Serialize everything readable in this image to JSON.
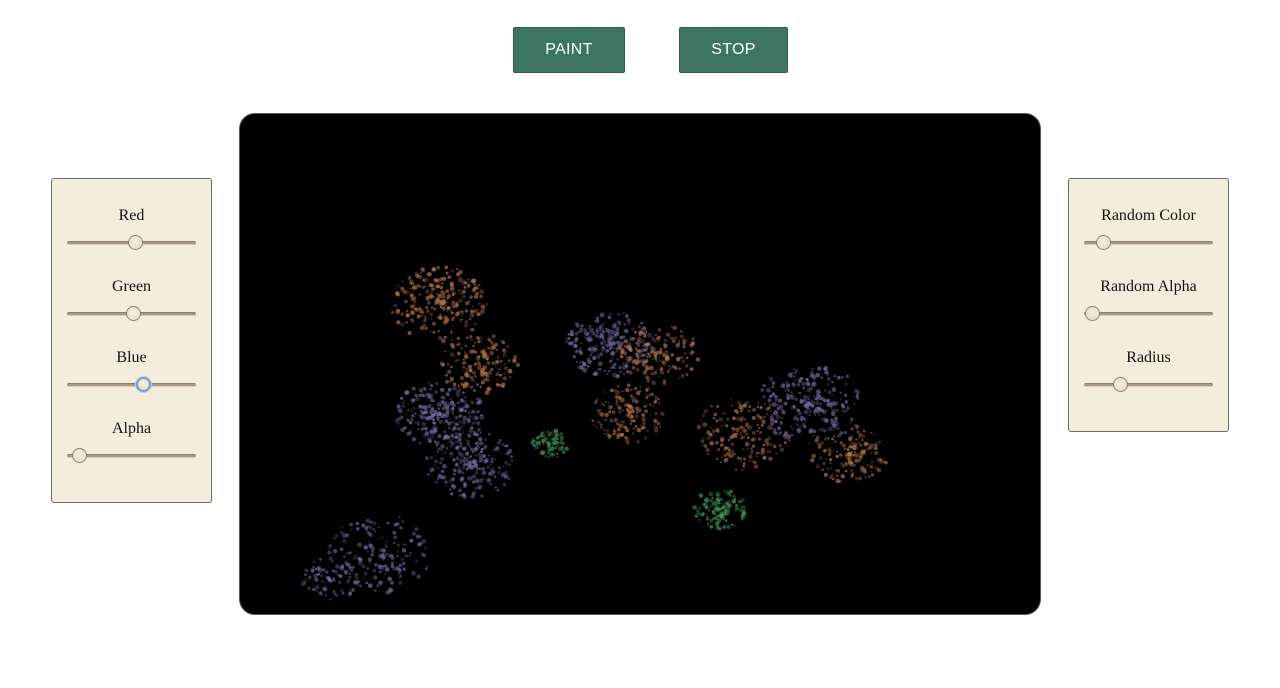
{
  "toolbar": {
    "paint_label": "PAINT",
    "stop_label": "STOP"
  },
  "left_panel": {
    "controls": [
      {
        "label": "Red",
        "value": 0.53
      },
      {
        "label": "Green",
        "value": 0.51
      },
      {
        "label": "Blue",
        "value": 0.59,
        "focused": true
      },
      {
        "label": "Alpha",
        "value": 0.09
      }
    ]
  },
  "right_panel": {
    "controls": [
      {
        "label": "Random Color",
        "value": 0.15
      },
      {
        "label": "Random Alpha",
        "value": 0.06
      },
      {
        "label": "Radius",
        "value": 0.28
      }
    ]
  },
  "colors": {
    "button_bg": "#3d7563",
    "panel_bg": "#f3eddc",
    "canvas_bg": "#000000",
    "paint_purple": "#7a6fa6",
    "paint_orange": "#b87a45",
    "paint_green": "#3f9a5a"
  }
}
